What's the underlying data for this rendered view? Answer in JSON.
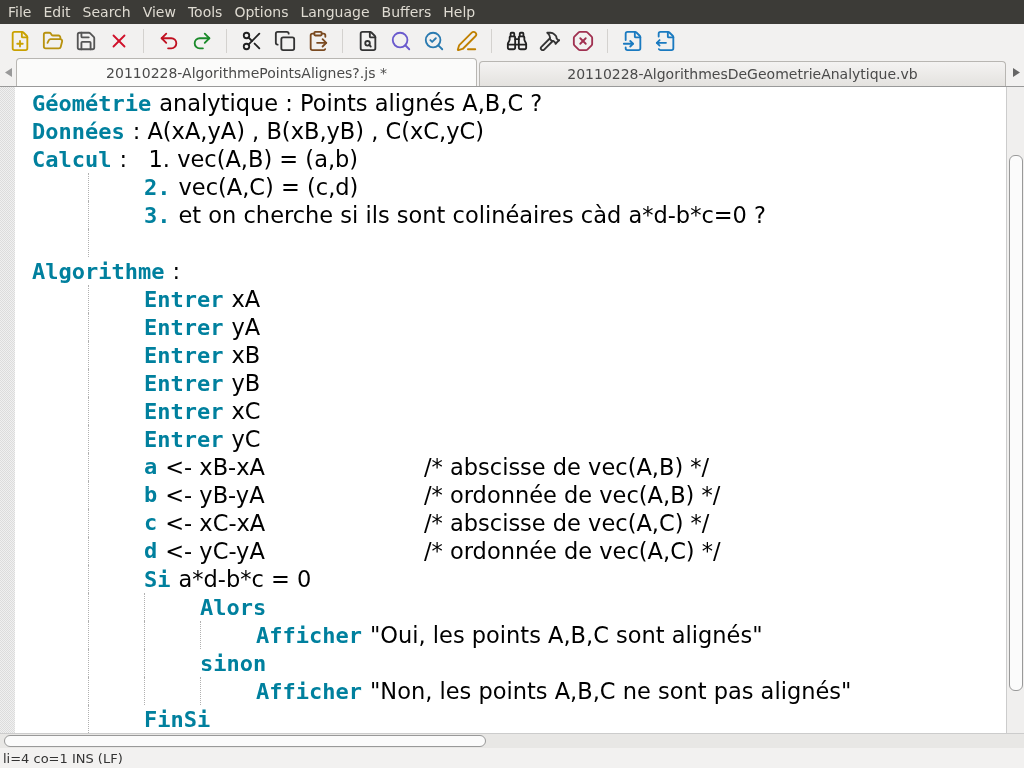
{
  "menu": [
    "File",
    "Edit",
    "Search",
    "View",
    "Tools",
    "Options",
    "Language",
    "Buffers",
    "Help"
  ],
  "toolbar": [
    {
      "kind": "new"
    },
    {
      "kind": "open"
    },
    {
      "kind": "save"
    },
    {
      "kind": "close"
    },
    {
      "kind": "sep"
    },
    {
      "kind": "undo"
    },
    {
      "kind": "redo"
    },
    {
      "kind": "sep"
    },
    {
      "kind": "cut"
    },
    {
      "kind": "copy"
    },
    {
      "kind": "paste"
    },
    {
      "kind": "sep"
    },
    {
      "kind": "find"
    },
    {
      "kind": "find-zoom"
    },
    {
      "kind": "find-next"
    },
    {
      "kind": "replace"
    },
    {
      "kind": "sep"
    },
    {
      "kind": "binoculars"
    },
    {
      "kind": "hammer"
    },
    {
      "kind": "stop"
    },
    {
      "kind": "sep"
    },
    {
      "kind": "prev-file"
    },
    {
      "kind": "next-file"
    }
  ],
  "tabs": [
    {
      "label": "20110228-AlgorithmePointsAlignes?.js *",
      "selected": true
    },
    {
      "label": "20110228-AlgorithmesDeGeometrieAnalytique.vb",
      "selected": false
    }
  ],
  "lines": [
    {
      "segments": [
        {
          "kind": "keyword",
          "text": "Géométrie"
        },
        {
          "kind": "text",
          "text": "analytique : Points alignés A,B,C ?"
        }
      ]
    },
    {
      "segments": [
        {
          "kind": "keyword",
          "text": "Données"
        },
        {
          "kind": "text",
          "text": ": A(xA,yA) , B(xB,yB) , C(xC,yC)"
        }
      ]
    },
    {
      "segments": [
        {
          "kind": "keyword",
          "text": "Calcul"
        },
        {
          "kind": "text",
          "text": ":   1. vec(A,B) = (a,b)"
        }
      ],
      "children": [
        {
          "segments": [
            {
              "kind": "keyword",
              "text": "2."
            },
            {
              "kind": "text",
              "text": "vec(A,C) = (c,d)"
            }
          ]
        },
        {
          "segments": [
            {
              "kind": "keyword",
              "text": "3."
            },
            {
              "kind": "text",
              "text": "et on cherche si ils sont colinéaires càd a*d-b*c=0 ?"
            }
          ]
        },
        {
          "kind": "blank"
        }
      ]
    },
    {
      "segments": [
        {
          "kind": "keyword",
          "text": "Algorithme"
        },
        {
          "kind": "text",
          "text": ":"
        }
      ],
      "children": [
        {
          "segments": [
            {
              "kind": "keyword",
              "text": "Entrer"
            },
            {
              "kind": "text",
              "text": "xA"
            }
          ]
        },
        {
          "segments": [
            {
              "kind": "keyword",
              "text": "Entrer"
            },
            {
              "kind": "text",
              "text": "yA"
            }
          ]
        },
        {
          "segments": [
            {
              "kind": "keyword",
              "text": "Entrer"
            },
            {
              "kind": "text",
              "text": "xB"
            }
          ]
        },
        {
          "segments": [
            {
              "kind": "keyword",
              "text": "Entrer"
            },
            {
              "kind": "text",
              "text": "yB"
            }
          ]
        },
        {
          "segments": [
            {
              "kind": "keyword",
              "text": "Entrer"
            },
            {
              "kind": "text",
              "text": "xC"
            }
          ]
        },
        {
          "segments": [
            {
              "kind": "keyword",
              "text": "Entrer"
            },
            {
              "kind": "text",
              "text": "yC"
            }
          ]
        },
        {
          "segments": [
            {
              "kind": "keyword",
              "text": "a"
            },
            {
              "kind": "text",
              "text": "<- xB-xA"
            }
          ],
          "comment": "/* abscisse de vec(A,B) */"
        },
        {
          "segments": [
            {
              "kind": "keyword",
              "text": "b"
            },
            {
              "kind": "text",
              "text": "<- yB-yA"
            }
          ],
          "comment": "/* ordonnée de vec(A,B) */"
        },
        {
          "segments": [
            {
              "kind": "keyword",
              "text": "c"
            },
            {
              "kind": "text",
              "text": "<- xC-xA"
            }
          ],
          "comment": "/* abscisse de vec(A,C) */"
        },
        {
          "segments": [
            {
              "kind": "keyword",
              "text": "d"
            },
            {
              "kind": "text",
              "text": "<- yC-yA"
            }
          ],
          "comment": "/* ordonnée de vec(A,C) */"
        },
        {
          "segments": [
            {
              "kind": "keyword",
              "text": "Si"
            },
            {
              "kind": "text",
              "text": "a*d-b*c = 0"
            }
          ],
          "children": [
            {
              "segments": [
                {
                  "kind": "keyword",
                  "text": "Alors"
                }
              ],
              "children": [
                {
                  "segments": [
                    {
                      "kind": "keyword",
                      "text": "Afficher"
                    },
                    {
                      "kind": "text",
                      "text": "\"Oui, les points A,B,C sont alignés\""
                    }
                  ]
                }
              ]
            },
            {
              "segments": [
                {
                  "kind": "keyword",
                  "text": "sinon"
                }
              ],
              "children": [
                {
                  "segments": [
                    {
                      "kind": "keyword",
                      "text": "Afficher"
                    },
                    {
                      "kind": "text",
                      "text": "\"Non, les points A,B,C ne sont pas alignés\""
                    }
                  ]
                }
              ]
            }
          ]
        },
        {
          "segments": [
            {
              "kind": "keyword",
              "text": "FinSi"
            }
          ]
        }
      ]
    }
  ],
  "status": "li=4 co=1 INS (LF)"
}
